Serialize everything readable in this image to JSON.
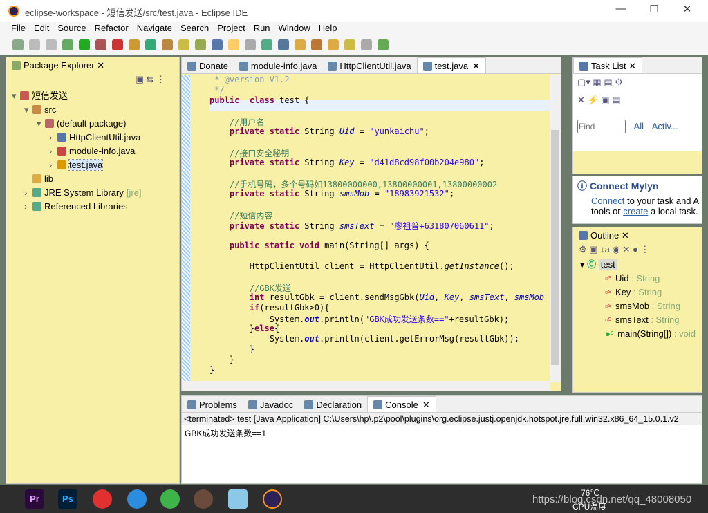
{
  "window": {
    "title": "eclipse-workspace - 短信发送/src/test.java - Eclipse IDE",
    "min": "—",
    "max": "☐",
    "close": "✕"
  },
  "menu": [
    "File",
    "Edit",
    "Source",
    "Refactor",
    "Navigate",
    "Search",
    "Project",
    "Run",
    "Window",
    "Help"
  ],
  "package_explorer": {
    "title": "Package Explorer",
    "items": [
      {
        "label": "短信发送",
        "depth": 0,
        "icon": "project-icon",
        "arrow": "▾"
      },
      {
        "label": "src",
        "depth": 1,
        "icon": "source-folder-icon",
        "arrow": "▾"
      },
      {
        "label": "(default package)",
        "depth": 2,
        "icon": "package-icon",
        "arrow": "▾"
      },
      {
        "label": "HttpClientUtil.java",
        "depth": 3,
        "icon": "java-file-icon",
        "arrow": "›"
      },
      {
        "label": "module-info.java",
        "depth": 3,
        "icon": "java-file-error-icon",
        "arrow": "›"
      },
      {
        "label": "test.java",
        "depth": 3,
        "icon": "java-file-warning-icon",
        "arrow": "›",
        "selected": true
      },
      {
        "label": "lib",
        "depth": 1,
        "icon": "folder-icon",
        "arrow": ""
      },
      {
        "label": "JRE System Library",
        "suffix": "[jre]",
        "depth": 1,
        "icon": "library-icon",
        "arrow": "›"
      },
      {
        "label": "Referenced Libraries",
        "depth": 1,
        "icon": "library-icon",
        "arrow": "›"
      }
    ]
  },
  "editor": {
    "tabs": [
      {
        "label": "Donate"
      },
      {
        "label": "module-info.java"
      },
      {
        "label": "HttpClientUtil.java"
      },
      {
        "label": "test.java",
        "active": true
      }
    ],
    "lines": [
      [
        [
          "jd",
          " * @version V1.2"
        ]
      ],
      [
        [
          "jd",
          " */"
        ]
      ],
      [
        [
          "kw",
          "public"
        ],
        [
          "",
          "  "
        ],
        [
          "kw",
          "class"
        ],
        [
          "",
          " test {"
        ]
      ],
      [],
      [
        [
          "cm",
          "    //用户名"
        ]
      ],
      [
        [
          "",
          "    "
        ],
        [
          "kw",
          "private static"
        ],
        [
          "",
          " String "
        ],
        [
          "fld",
          "Uid"
        ],
        [
          "",
          " = "
        ],
        [
          "str",
          "\"yunkaichu\""
        ],
        [
          "",
          ";"
        ]
      ],
      [],
      [
        [
          "cm",
          "    //接口安全秘钥"
        ]
      ],
      [
        [
          "",
          "    "
        ],
        [
          "kw",
          "private static"
        ],
        [
          "",
          " String "
        ],
        [
          "fld",
          "Key"
        ],
        [
          "",
          " = "
        ],
        [
          "str",
          "\"d41d8cd98f00b204e980\""
        ],
        [
          "",
          ";"
        ]
      ],
      [],
      [
        [
          "cm",
          "    //手机号码，多个号码如13800000000,13800000001,13800000002"
        ]
      ],
      [
        [
          "",
          "    "
        ],
        [
          "kw",
          "private static"
        ],
        [
          "",
          " String "
        ],
        [
          "fld",
          "smsMob"
        ],
        [
          "",
          " = "
        ],
        [
          "str",
          "\"18983921532\""
        ],
        [
          "",
          ";"
        ]
      ],
      [],
      [
        [
          "cm",
          "    //短信内容"
        ]
      ],
      [
        [
          "",
          "    "
        ],
        [
          "kw",
          "private static"
        ],
        [
          "",
          " String "
        ],
        [
          "fld",
          "smsText"
        ],
        [
          "",
          " = "
        ],
        [
          "str",
          "\"廖祖普+631807060611\""
        ],
        [
          "",
          ";"
        ]
      ],
      [],
      [
        [
          "",
          "    "
        ],
        [
          "kw",
          "public static void"
        ],
        [
          "",
          " main(String[] args) {"
        ]
      ],
      [],
      [
        [
          "",
          "        HttpClientUtil client = HttpClientUtil."
        ],
        [
          "it",
          "getInstance"
        ],
        [
          "",
          "();"
        ]
      ],
      [],
      [
        [
          "cm",
          "        //GBK发送"
        ]
      ],
      [
        [
          "",
          "        "
        ],
        [
          "kw",
          "int"
        ],
        [
          "",
          " resultGbk = client.sendMsgGbk("
        ],
        [
          "fld",
          "Uid"
        ],
        [
          "",
          ", "
        ],
        [
          "fld",
          "Key"
        ],
        [
          "",
          ", "
        ],
        [
          "fld",
          "smsText"
        ],
        [
          "",
          ", "
        ],
        [
          "fld",
          "smsMob"
        ],
        [
          "",
          " );"
        ]
      ],
      [
        [
          "",
          "        "
        ],
        [
          "kw",
          "if"
        ],
        [
          "",
          "(resultGbk>0){"
        ]
      ],
      [
        [
          "",
          "            System."
        ],
        [
          "st",
          "out"
        ],
        [
          "",
          ".println("
        ],
        [
          "str",
          "\"GBK成功发送条数==\""
        ],
        [
          "",
          "+resultGbk);"
        ]
      ],
      [
        [
          "",
          "        }"
        ],
        [
          "kw",
          "else"
        ],
        [
          "",
          "{"
        ]
      ],
      [
        [
          "",
          "            System."
        ],
        [
          "st",
          "out"
        ],
        [
          "",
          ".println(client.getErrorMsg(resultGbk));"
        ]
      ],
      [
        [
          "",
          "        }"
        ]
      ],
      [
        [
          "",
          "    }"
        ]
      ],
      [
        [
          "",
          "}"
        ]
      ],
      []
    ],
    "first_line": 7
  },
  "task_list": {
    "title": "Task List",
    "find_placeholder": "Find",
    "all": "All",
    "activate": "Activ..."
  },
  "mylyn": {
    "title": "Connect Mylyn",
    "connect": "Connect",
    "text1": " to your task and A",
    "text2": "tools or ",
    "create": "create",
    "text3": " a local task."
  },
  "outline": {
    "title": "Outline",
    "class": "test",
    "members": [
      {
        "name": "Uid",
        "type": " : String"
      },
      {
        "name": "Key",
        "type": " : String"
      },
      {
        "name": "smsMob",
        "type": " : String"
      },
      {
        "name": "smsText",
        "type": " : String"
      },
      {
        "name": "main(String[])",
        "type": " : void",
        "method": true
      }
    ]
  },
  "console": {
    "tabs": [
      {
        "label": "Problems"
      },
      {
        "label": "Javadoc"
      },
      {
        "label": "Declaration"
      },
      {
        "label": "Console",
        "active": true
      }
    ],
    "status": "<terminated> test [Java Application] C:\\Users\\hp\\.p2\\pool\\plugins\\org.eclipse.justj.openjdk.hotspot.jre.full.win32.x86_64_15.0.1.v2",
    "output": "GBK成功发送条数==1"
  },
  "taskbar": {
    "temp": "76℃",
    "temp_label": "CPU温度",
    "watermark": "https://blog.csdn.net/qq_48008050"
  }
}
